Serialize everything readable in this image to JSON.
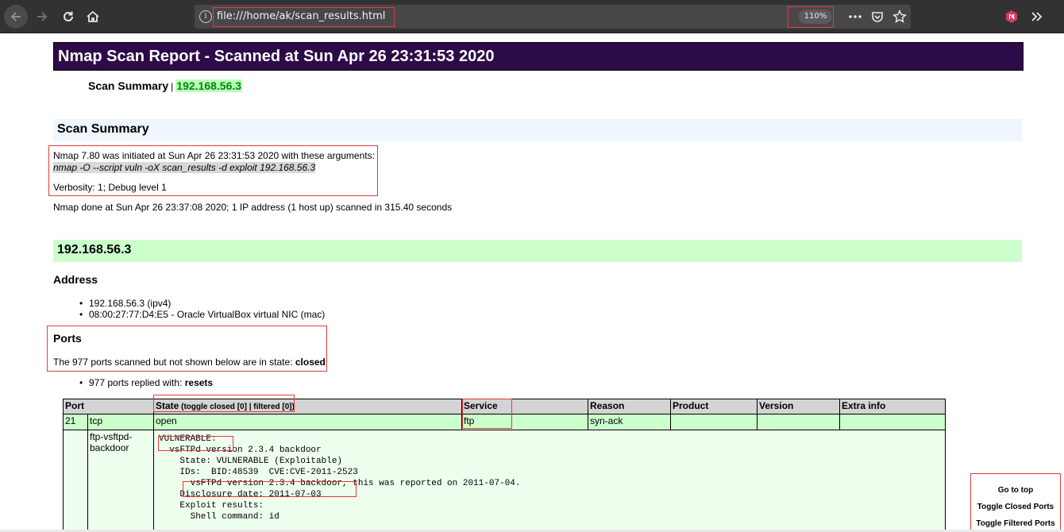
{
  "browser": {
    "url": "file:///home/ak/scan_results.html",
    "zoom": "110%",
    "icons": [
      "back-arrow-icon",
      "forward-arrow-icon",
      "reload-icon",
      "home-icon",
      "info-icon",
      "more-actions-icon",
      "pocket-icon",
      "bookmark-star-icon",
      "extension-icon",
      "overflow-chevrons-icon"
    ]
  },
  "report": {
    "title": "Nmap Scan Report - Scanned at Sun Apr 26 23:31:53 2020",
    "nav_summary_label": "Scan Summary",
    "nav_separator": "|",
    "nav_host_link": "192.168.56.3"
  },
  "scan_summary": {
    "heading": "Scan Summary",
    "initiated": "Nmap 7.80 was initiated at Sun Apr 26 23:31:53 2020 with these arguments:",
    "arguments": "nmap -O --script vuln -oX scan_results -d exploit 192.168.56.3",
    "verbosity": "Verbosity: 1; Debug level 1",
    "done": "Nmap done at Sun Apr 26 23:37:08 2020; 1 IP address (1 host up) scanned in 315.40 seconds"
  },
  "host": {
    "heading": "192.168.56.3",
    "address_heading": "Address",
    "addresses": [
      "192.168.56.3 (ipv4)",
      "08:00:27:77:D4:E5 - Oracle VirtualBox virtual NIC (mac)"
    ],
    "ports_heading": "Ports",
    "closed_prefix": "The 977 ports scanned but not shown below are in state: ",
    "closed_state": "closed",
    "reset_prefix": "977 ports replied with: ",
    "reset_value": "resets"
  },
  "ports_table": {
    "headers": {
      "port": "Port",
      "state": "State",
      "state_toggle_open": " (toggle ",
      "toggle_closed": "closed [0]",
      "toggle_sep": " | ",
      "toggle_filtered": "filtered [0]",
      "state_toggle_close": ")",
      "service": "Service",
      "reason": "Reason",
      "product": "Product",
      "version": "Version",
      "extra": "Extra info"
    },
    "row": {
      "port": "21",
      "protocol": "tcp",
      "state": "open",
      "service": "ftp",
      "reason": "syn-ack",
      "product": "",
      "version": "",
      "extra": ""
    },
    "script": {
      "id": "ftp-vsftpd-backdoor",
      "output": "VULNERABLE:\n  vsFTPd version 2.3.4 backdoor\n    State: VULNERABLE (Exploitable)\n    IDs:  BID:48539  CVE:CVE-2011-2523\n      vsFTPd version 2.3.4 backdoor, this was reported on 2011-07-04.\n    Disclosure date: 2011-07-03\n    Exploit results:\n      Shell command: id"
    }
  },
  "floating_menu": {
    "go_top": "Go to top",
    "toggle_closed": "Toggle Closed Ports",
    "toggle_filtered": "Toggle Filtered Ports"
  }
}
